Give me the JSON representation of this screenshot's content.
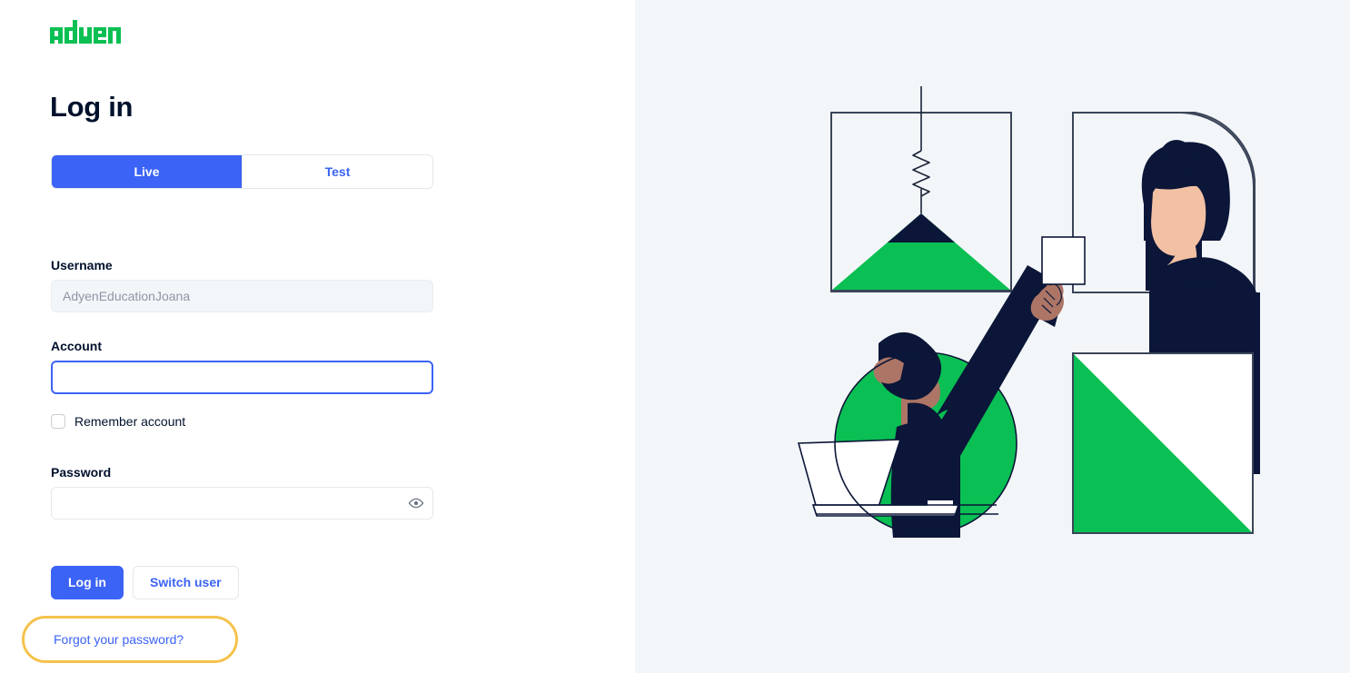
{
  "brand": {
    "logo_text": "adyen",
    "logo_color": "#0ABF53",
    "accent_blue": "#3B63F5",
    "ink": "#00112C",
    "panel_bg": "#F3F6F9",
    "highlight_amber": "#F5C24C",
    "illustration_green": "#0ABF53",
    "skin_light": "#F2C0A3",
    "skin_dark": "#AD7566"
  },
  "page_title": "Log in",
  "environment_toggle": {
    "name": "environment-switch",
    "options": [
      {
        "label": "Live",
        "selected": true
      },
      {
        "label": "Test",
        "selected": false
      }
    ]
  },
  "form": {
    "username": {
      "label": "Username",
      "value": "AdyenEducationJoana",
      "placeholder": "",
      "disabled": true
    },
    "account": {
      "label": "Account",
      "value": "",
      "placeholder": "",
      "focused": true
    },
    "remember": {
      "label": "Remember account",
      "checked": false
    },
    "password": {
      "label": "Password",
      "value": "",
      "placeholder": "",
      "reveal_icon": "eye-icon"
    }
  },
  "actions": {
    "login_label": "Log in",
    "switch_user_label": "Switch user",
    "forgot_password_label": "Forgot your password?"
  },
  "illustration": {
    "name": "adyen-login-illustration",
    "description": "Person holding a card beside geometric frames, a pendulum with spring, a green triangle square and a laptop scene"
  }
}
